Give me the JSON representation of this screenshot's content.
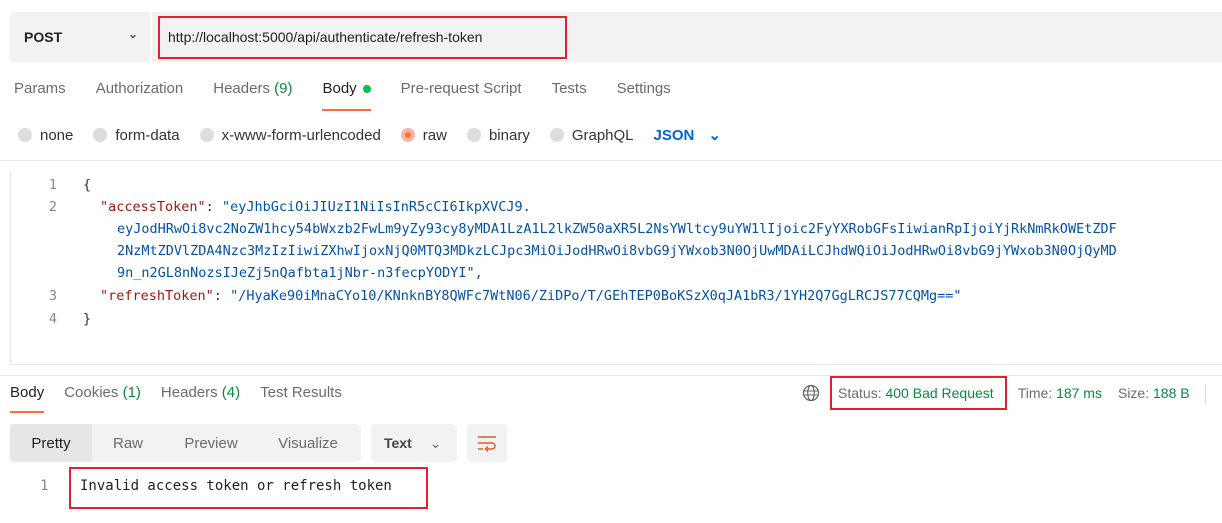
{
  "request": {
    "method": "POST",
    "url": "http://localhost:5000/api/authenticate/refresh-token"
  },
  "tabs": [
    {
      "label": "Params"
    },
    {
      "label": "Authorization"
    },
    {
      "label": "Headers",
      "count": "(9)"
    },
    {
      "label": "Body"
    },
    {
      "label": "Pre-request Script"
    },
    {
      "label": "Tests"
    },
    {
      "label": "Settings"
    }
  ],
  "body_types": [
    "none",
    "form-data",
    "x-www-form-urlencoded",
    "raw",
    "binary",
    "GraphQL"
  ],
  "body_format": "JSON",
  "code": {
    "lines": [
      "1",
      "2",
      "3",
      "4"
    ],
    "open": "{",
    "close": "}",
    "key1": "\"accessToken\"",
    "val1a": "\"eyJhbGciOiJIUzI1NiIsInR5cCI6IkpXVCJ9.",
    "val1b": "eyJodHRwOi8vc2NoZW1hcy54bWxzb2FwLm9yZy93cy8yMDA1LzA1L2lkZW50aXR5L2NsYWltcy9uYW1lIjoic2FyYXRobGFsIiwianRpIjoiYjRkNmRkOWEtZDF",
    "val1c": "2NzMtZDVlZDA4Nzc3MzIzIiwiZXhwIjoxNjQ0MTQ3MDkzLCJpc3MiOiJodHRwOi8vbG9jYWxob3N0OjUwMDAiLCJhdWQiOiJodHRwOi8vbG9jYWxob3N0OjQyMD",
    "val1d": "9n_n2GL8nNozsIJeZj5nQafbta1jNbr-n3fecpYODYI\",",
    "key2": "\"refreshToken\"",
    "val2": "\"/HyaKe90iMnaCYo10/KNnknBY8QWFc7WtN06/ZiDPo/T/GEhTEP0BoKSzX0qJA1bR3/1YH2Q7GgLRCJS77CQMg==\""
  },
  "response": {
    "tabs": [
      {
        "label": "Body"
      },
      {
        "label": "Cookies",
        "count": "(1)"
      },
      {
        "label": "Headers",
        "count": "(4)"
      },
      {
        "label": "Test Results"
      }
    ],
    "status_label": "Status:",
    "status": "400 Bad Request",
    "time_label": "Time:",
    "time": "187 ms",
    "size_label": "Size:",
    "size": "188 B",
    "views": [
      "Pretty",
      "Raw",
      "Preview",
      "Visualize"
    ],
    "format": "Text",
    "line": "1",
    "text": "Invalid access token or refresh token"
  }
}
